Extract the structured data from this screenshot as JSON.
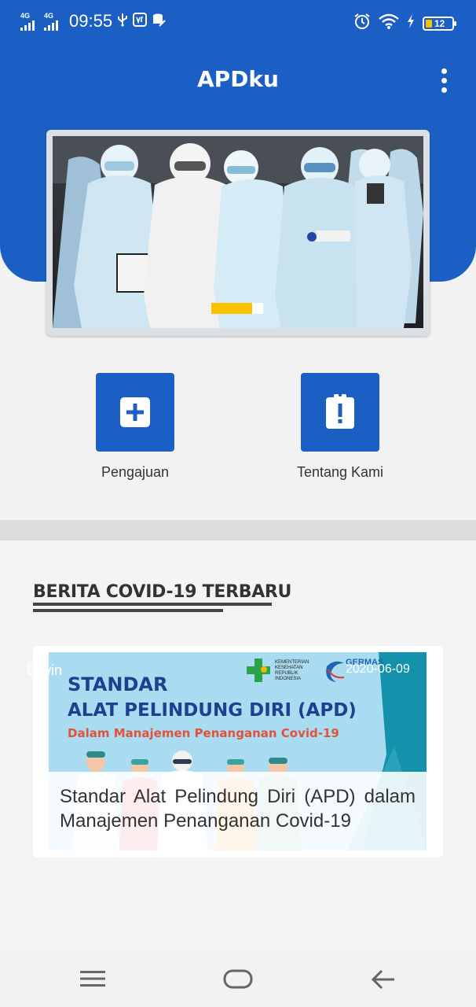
{
  "status_bar": {
    "network1": "4G",
    "network2": "4G",
    "time": "09:55",
    "battery": "12"
  },
  "app": {
    "title": "APDku"
  },
  "banner": {
    "slide_count": 2,
    "active_slide": 1
  },
  "actions": [
    {
      "label": "Pengajuan",
      "icon": "plus-icon"
    },
    {
      "label": "Tentang Kami",
      "icon": "clipboard-alert-icon"
    }
  ],
  "news": {
    "section_title": "BERITA COVID-19 TERBARU",
    "items": [
      {
        "author": "Erwin",
        "date": "2020-06-09",
        "title": "Standar Alat Pelindung Diri (APD) dalam Manajemen Penanganan Covid-19",
        "poster": {
          "line1": "STANDAR",
          "line2": "ALAT PELINDUNG DIRI (APD)",
          "line3": "Dalam Manajemen Penanganan Covid-19",
          "ministry": "KEMENTERIAN KESEHATAN REPUBLIK INDONESIA",
          "germas": "GERMAS"
        }
      }
    ]
  },
  "colors": {
    "primary": "#1c5fc4",
    "accent": "#f9c100"
  }
}
